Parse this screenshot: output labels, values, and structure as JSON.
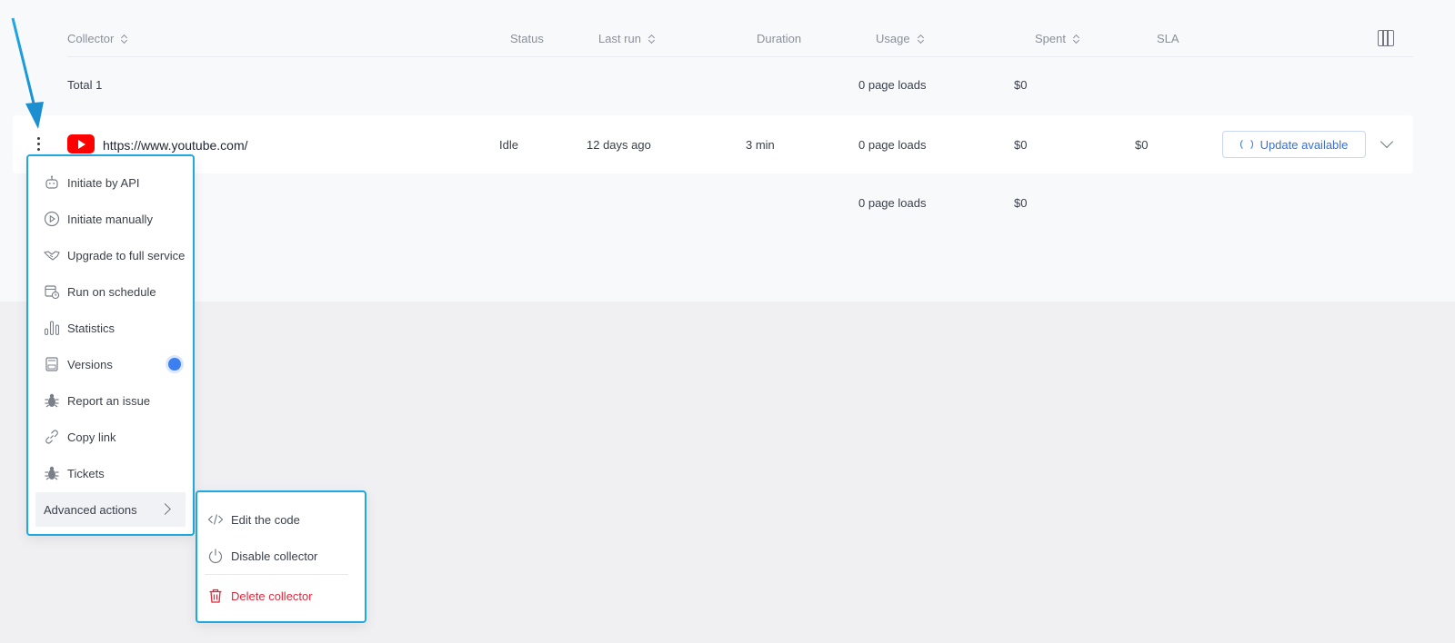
{
  "table": {
    "headers": {
      "collector": "Collector",
      "status": "Status",
      "last_run": "Last run",
      "duration": "Duration",
      "usage": "Usage",
      "spent": "Spent",
      "sla": "SLA"
    },
    "total_row": {
      "label": "Total 1",
      "usage": "0 page loads",
      "spent": "$0"
    },
    "rows": [
      {
        "url": "https://www.youtube.com/",
        "status": "Idle",
        "last_run": "12 days ago",
        "duration": "3 min",
        "usage": "0 page loads",
        "spent": "$0",
        "sla": "$0",
        "update_label": "Update available",
        "icon": "youtube-logo"
      }
    ],
    "footer_row": {
      "usage": "0 page loads",
      "spent": "$0"
    }
  },
  "context_menu": {
    "items": [
      {
        "label": "Initiate by API",
        "icon": "robot-icon"
      },
      {
        "label": "Initiate manually",
        "icon": "play-circle-icon"
      },
      {
        "label": "Upgrade to full service",
        "icon": "handshake-icon"
      },
      {
        "label": "Run on schedule",
        "icon": "calendar-clock-icon"
      },
      {
        "label": "Statistics",
        "icon": "bar-chart-icon"
      },
      {
        "label": "Versions",
        "icon": "versions-icon",
        "badge": true
      },
      {
        "label": "Report an issue",
        "icon": "bug-icon"
      },
      {
        "label": "Copy link",
        "icon": "link-icon"
      },
      {
        "label": "Tickets",
        "icon": "bug-icon"
      },
      {
        "label": "Advanced actions",
        "icon": "chevron-right-icon"
      }
    ]
  },
  "advanced_menu": {
    "items": [
      {
        "label": "Edit the code",
        "icon": "code-icon"
      },
      {
        "label": "Disable collector",
        "icon": "power-icon"
      },
      {
        "label": "Delete collector",
        "icon": "trash-icon"
      }
    ]
  },
  "colors": {
    "accent": "#1fa9e1",
    "link_blue": "#3a6fd6",
    "danger": "#e0283b",
    "badge_blue": "#3b7ff0",
    "youtube_red": "#ff0000"
  }
}
